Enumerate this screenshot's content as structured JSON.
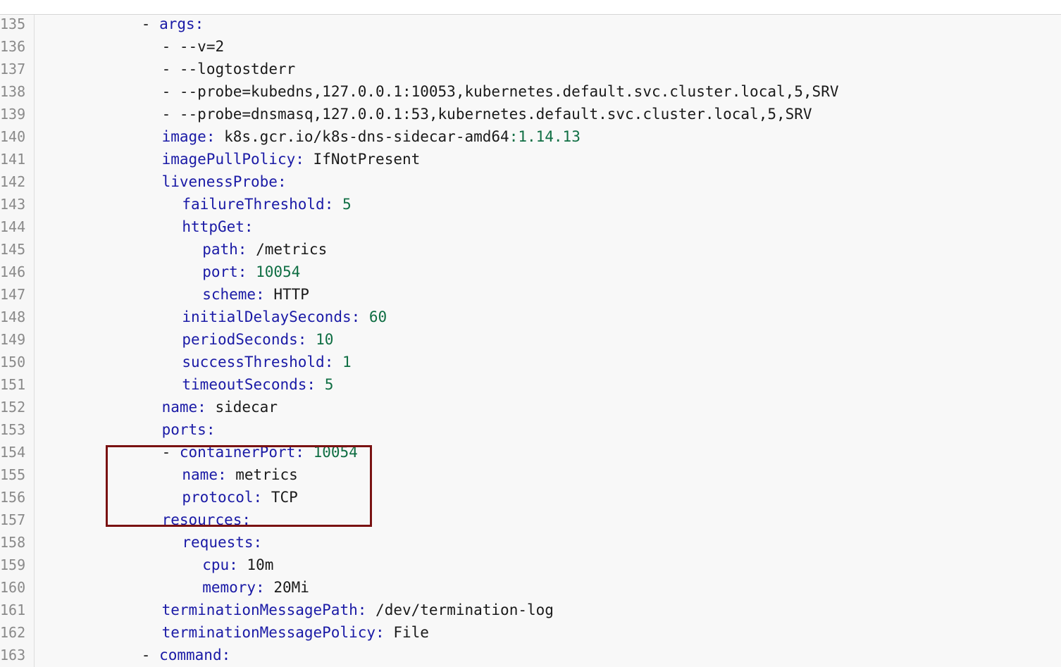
{
  "editor": {
    "lines": [
      {
        "n": "135",
        "indent": 6,
        "dash": "- ",
        "key": "args",
        "sep": ":",
        "value": "",
        "vtype": "str"
      },
      {
        "n": "136",
        "indent": 7,
        "dash": "- ",
        "key": "",
        "sep": "",
        "value": "--v=2",
        "vtype": "str"
      },
      {
        "n": "137",
        "indent": 7,
        "dash": "- ",
        "key": "",
        "sep": "",
        "value": "--logtostderr",
        "vtype": "str"
      },
      {
        "n": "138",
        "indent": 7,
        "dash": "- ",
        "key": "",
        "sep": "",
        "value": "--probe=kubedns,127.0.0.1:10053,kubernetes.default.svc.cluster.local,5,SRV",
        "vtype": "str"
      },
      {
        "n": "139",
        "indent": 7,
        "dash": "- ",
        "key": "",
        "sep": "",
        "value": "--probe=dnsmasq,127.0.0.1:53,kubernetes.default.svc.cluster.local,5,SRV",
        "vtype": "str"
      },
      {
        "n": "140",
        "indent": 7,
        "dash": "",
        "key": "image",
        "sep": ": ",
        "value": "k8s.gcr.io/k8s-dns-sidecar-amd64",
        "vtype": "str",
        "extra": ":1.14.13"
      },
      {
        "n": "141",
        "indent": 7,
        "dash": "",
        "key": "imagePullPolicy",
        "sep": ": ",
        "value": "IfNotPresent",
        "vtype": "str"
      },
      {
        "n": "142",
        "indent": 7,
        "dash": "",
        "key": "livenessProbe",
        "sep": ":",
        "value": "",
        "vtype": "str"
      },
      {
        "n": "143",
        "indent": 8,
        "dash": "",
        "key": "failureThreshold",
        "sep": ": ",
        "value": "5",
        "vtype": "num"
      },
      {
        "n": "144",
        "indent": 8,
        "dash": "",
        "key": "httpGet",
        "sep": ":",
        "value": "",
        "vtype": "str"
      },
      {
        "n": "145",
        "indent": 9,
        "dash": "",
        "key": "path",
        "sep": ": ",
        "value": "/metrics",
        "vtype": "str"
      },
      {
        "n": "146",
        "indent": 9,
        "dash": "",
        "key": "port",
        "sep": ": ",
        "value": "10054",
        "vtype": "num"
      },
      {
        "n": "147",
        "indent": 9,
        "dash": "",
        "key": "scheme",
        "sep": ": ",
        "value": "HTTP",
        "vtype": "str"
      },
      {
        "n": "148",
        "indent": 8,
        "dash": "",
        "key": "initialDelaySeconds",
        "sep": ": ",
        "value": "60",
        "vtype": "num"
      },
      {
        "n": "149",
        "indent": 8,
        "dash": "",
        "key": "periodSeconds",
        "sep": ": ",
        "value": "10",
        "vtype": "num"
      },
      {
        "n": "150",
        "indent": 8,
        "dash": "",
        "key": "successThreshold",
        "sep": ": ",
        "value": "1",
        "vtype": "num"
      },
      {
        "n": "151",
        "indent": 8,
        "dash": "",
        "key": "timeoutSeconds",
        "sep": ": ",
        "value": "5",
        "vtype": "num"
      },
      {
        "n": "152",
        "indent": 7,
        "dash": "",
        "key": "name",
        "sep": ": ",
        "value": "sidecar",
        "vtype": "str"
      },
      {
        "n": "153",
        "indent": 7,
        "dash": "",
        "key": "ports",
        "sep": ":",
        "value": "",
        "vtype": "str"
      },
      {
        "n": "154",
        "indent": 7,
        "dash": "- ",
        "key": "containerPort",
        "sep": ": ",
        "value": "10054",
        "vtype": "num"
      },
      {
        "n": "155",
        "indent": 8,
        "dash": "",
        "key": "name",
        "sep": ": ",
        "value": "metrics",
        "vtype": "str"
      },
      {
        "n": "156",
        "indent": 8,
        "dash": "",
        "key": "protocol",
        "sep": ": ",
        "value": "TCP",
        "vtype": "str"
      },
      {
        "n": "157",
        "indent": 7,
        "dash": "",
        "key": "resources",
        "sep": ":",
        "value": "",
        "vtype": "str"
      },
      {
        "n": "158",
        "indent": 8,
        "dash": "",
        "key": "requests",
        "sep": ":",
        "value": "",
        "vtype": "str"
      },
      {
        "n": "159",
        "indent": 9,
        "dash": "",
        "key": "cpu",
        "sep": ": ",
        "value": "10m",
        "vtype": "str"
      },
      {
        "n": "160",
        "indent": 9,
        "dash": "",
        "key": "memory",
        "sep": ": ",
        "value": "20Mi",
        "vtype": "str"
      },
      {
        "n": "161",
        "indent": 7,
        "dash": "",
        "key": "terminationMessagePath",
        "sep": ": ",
        "value": "/dev/termination-log",
        "vtype": "str"
      },
      {
        "n": "162",
        "indent": 7,
        "dash": "",
        "key": "terminationMessagePolicy",
        "sep": ": ",
        "value": "File",
        "vtype": "str"
      },
      {
        "n": "163",
        "indent": 6,
        "dash": "- ",
        "key": "command",
        "sep": ":",
        "value": "",
        "vtype": "str"
      }
    ]
  },
  "colors": {
    "key": "#1a1aa6",
    "number": "#0f6e43",
    "text": "#1a1a1a",
    "line_number": "#8a8a8a",
    "highlight_border": "#7a1212",
    "background": "#f8f8f8"
  }
}
